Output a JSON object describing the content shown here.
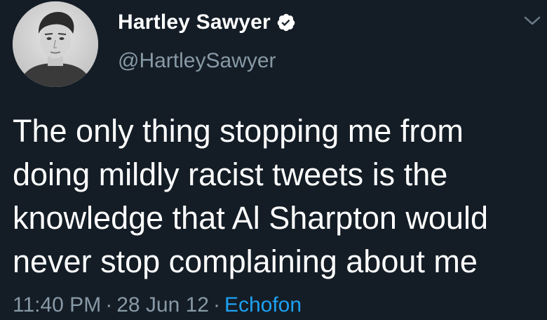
{
  "tweet": {
    "display_name": "Hartley Sawyer",
    "handle": "@HartleySawyer",
    "verified": true,
    "text_lines": [
      "The only thing stopping me from",
      "doing mildly racist tweets is the",
      "knowledge that Al Sharpton would",
      "never stop complaining about me"
    ],
    "time": "11:40 PM",
    "date": "28 Jun 12",
    "separator": "·",
    "source": "Echofon"
  },
  "icons": {
    "verified": "verified-badge-icon",
    "menu": "chevron-down-icon"
  },
  "colors": {
    "background": "#141d26",
    "text_primary": "#ffffff",
    "text_secondary": "#8899a6",
    "link": "#1da1f2"
  }
}
